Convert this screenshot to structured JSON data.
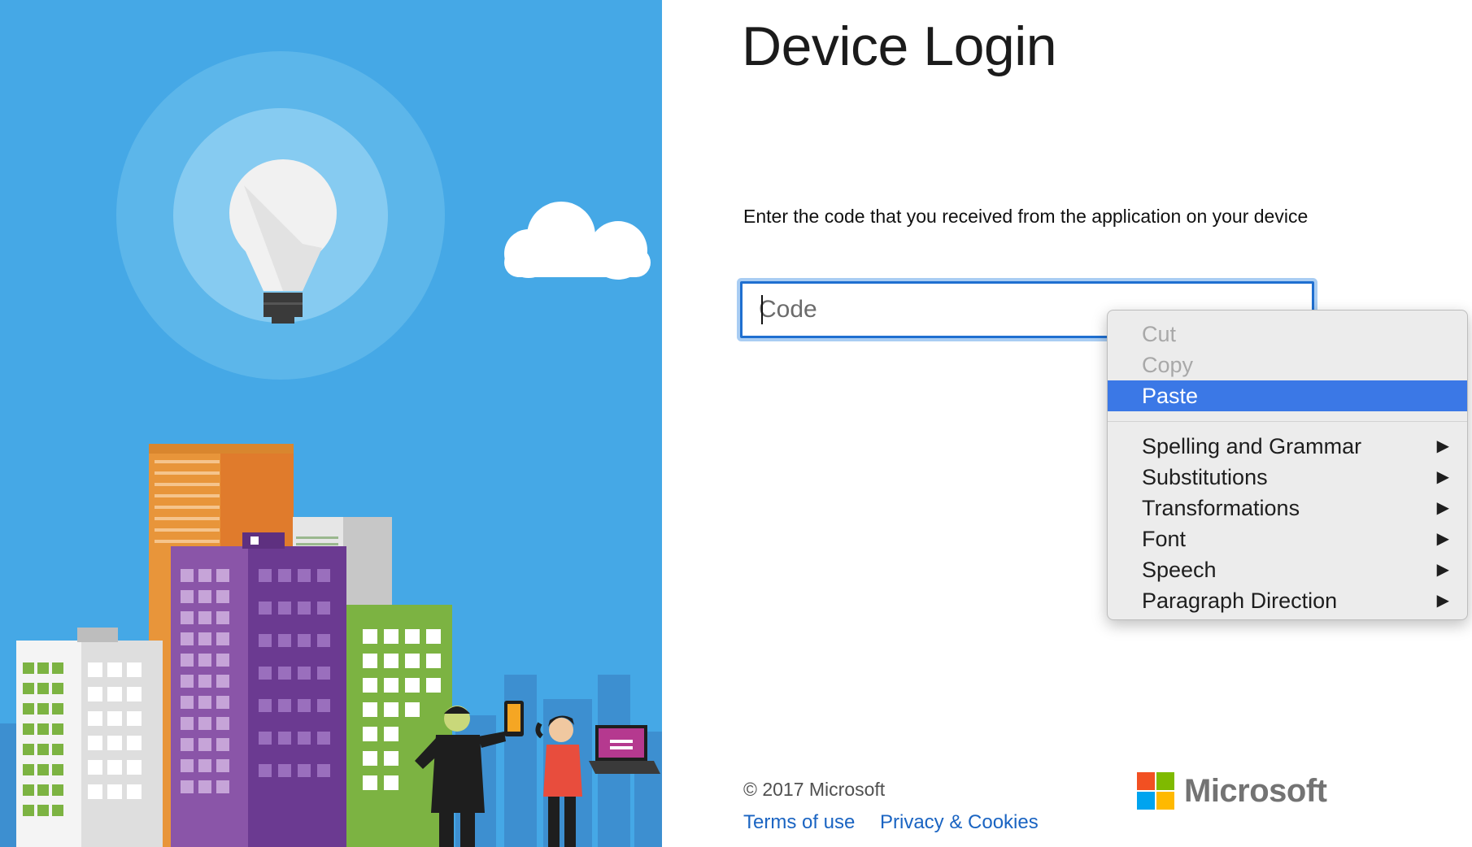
{
  "page": {
    "title": "Device Login",
    "instructions": "Enter the code that you received from the application on your device"
  },
  "code_field": {
    "placeholder": "Code",
    "value": ""
  },
  "footer": {
    "copyright": "© 2017 Microsoft",
    "terms_label": "Terms of use",
    "privacy_label": "Privacy & Cookies",
    "brand_name": "Microsoft"
  },
  "context_menu": {
    "group1": [
      {
        "label": "Cut",
        "state": "disabled"
      },
      {
        "label": "Copy",
        "state": "disabled"
      },
      {
        "label": "Paste",
        "state": "highlighted"
      }
    ],
    "group2": [
      {
        "label": "Spelling and Grammar",
        "submenu": true
      },
      {
        "label": "Substitutions",
        "submenu": true
      },
      {
        "label": "Transformations",
        "submenu": true
      },
      {
        "label": "Font",
        "submenu": true
      },
      {
        "label": "Speech",
        "submenu": true
      },
      {
        "label": "Paragraph Direction",
        "submenu": true
      }
    ],
    "submenu_glyph": "▶"
  },
  "icons": {
    "hero": "city-lightbulb-illustration",
    "logo": "microsoft-logo-icon",
    "submenu": "submenu-arrow-icon"
  },
  "colors": {
    "hero_background": "#45a8e6",
    "link": "#1a64c2",
    "input_focus": "#1f6fd0",
    "menu_highlight": "#3b78e6",
    "ms_red": "#f25022",
    "ms_green": "#7fba00",
    "ms_blue": "#00a4ef",
    "ms_yellow": "#ffb900"
  }
}
